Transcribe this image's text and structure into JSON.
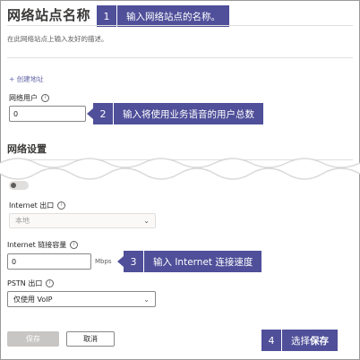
{
  "header": {
    "title": "网络站点名称",
    "description": "在此网络站点上输入友好的描述。"
  },
  "add_address_link": "+ 创建地址",
  "network_users": {
    "label": "网络用户",
    "value": "0"
  },
  "network_settings": {
    "heading": "网络设置"
  },
  "internet_egress": {
    "label": "Internet 出口",
    "selected": "本地"
  },
  "internet_capacity": {
    "label": "Internet 链接容量",
    "value": "0",
    "unit": "Mbps"
  },
  "pstn_egress": {
    "label": "PSTN 出口",
    "selected": "仅使用 VoIP"
  },
  "buttons": {
    "save": "保存",
    "cancel": "取消"
  },
  "callouts": [
    {
      "num": "1",
      "text": "输入网络站点的名称。"
    },
    {
      "num": "2",
      "text": "输入将使用业务语音的用户总数"
    },
    {
      "num": "3",
      "text": "输入 Internet 连接速度"
    },
    {
      "num": "4",
      "text_prefix": "选择",
      "text_bold": "保存"
    }
  ],
  "colors": {
    "callout": "#4f4f9a",
    "link": "#6264a7"
  }
}
